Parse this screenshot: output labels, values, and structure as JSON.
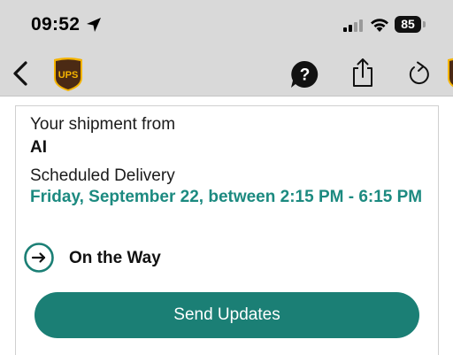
{
  "status_bar": {
    "time": "09:52",
    "battery": "85"
  },
  "nav": {
    "logo_text": "UPS"
  },
  "shipment": {
    "from_label": "Your shipment from",
    "from_value": "AI",
    "delivery_label": "Scheduled Delivery",
    "delivery_value": "Friday, September 22, between 2:15 PM - 6:15 PM",
    "status": "On the Way"
  },
  "actions": {
    "send_updates": "Send Updates"
  },
  "colors": {
    "accent_teal": "#1b7f75",
    "date_teal": "#1c8a80",
    "ups_brown": "#4b2a14",
    "ups_gold": "#f5b400",
    "status_bar_bg": "#d9d9d9"
  },
  "icons": {
    "location": "location-arrow-icon",
    "signal": "cellular-signal-icon",
    "wifi": "wifi-icon",
    "back": "chevron-left-icon",
    "help": "question-mark-icon",
    "share": "share-icon",
    "refresh": "refresh-icon",
    "status": "arrow-right-circle-icon"
  }
}
